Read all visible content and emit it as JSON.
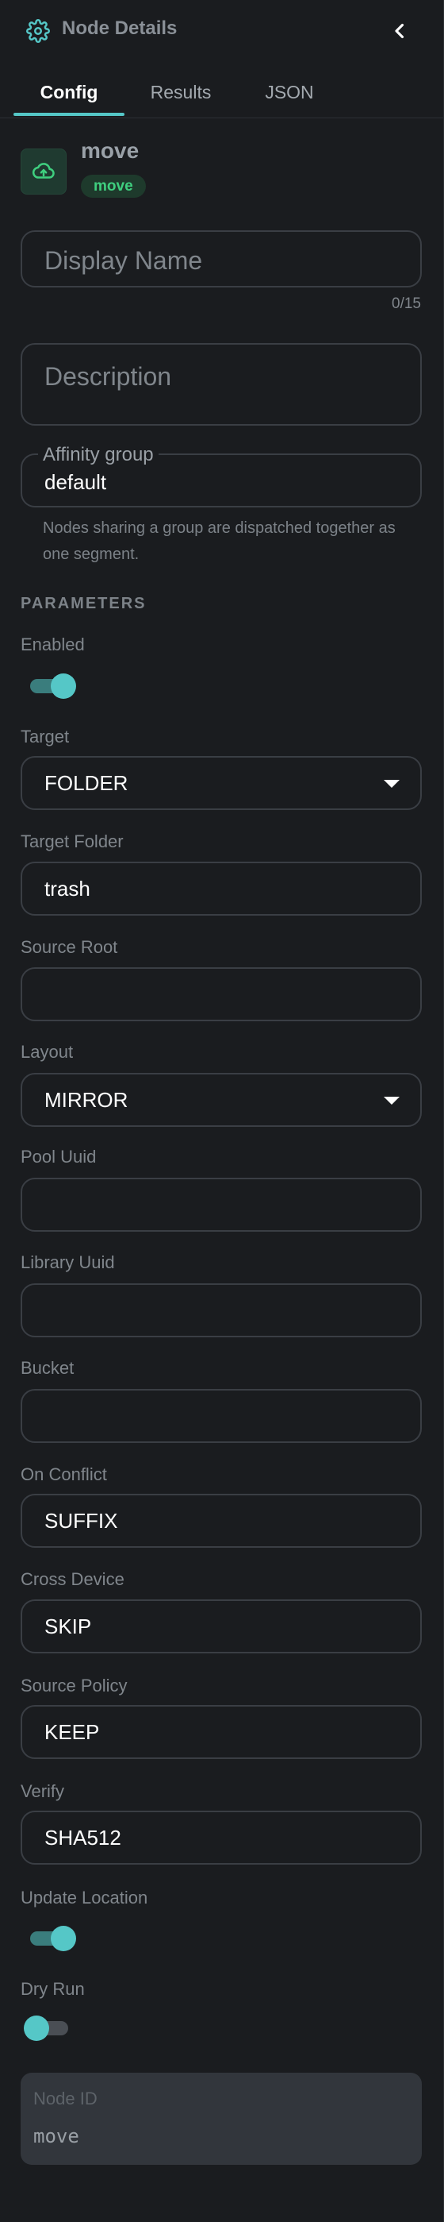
{
  "header": {
    "title": "Node Details",
    "icon": "gear-icon",
    "back_icon": "chevron-left-icon"
  },
  "tabs": [
    {
      "label": "Config",
      "active": true
    },
    {
      "label": "Results",
      "active": false
    },
    {
      "label": "JSON",
      "active": false
    }
  ],
  "node": {
    "name": "move",
    "badge": "move",
    "icon": "cloud-upload-icon",
    "badge_color": "#3fcf7f"
  },
  "display_name": {
    "placeholder": "Display Name",
    "value": "",
    "counter": "0/15"
  },
  "description": {
    "placeholder": "Description",
    "value": ""
  },
  "affinity": {
    "label": "Affinity group",
    "value": "default",
    "helper": "Nodes sharing a group are dispatched together as one segment."
  },
  "parameters": {
    "title": "PARAMETERS",
    "enabled": {
      "label": "Enabled",
      "on": true
    },
    "target": {
      "label": "Target",
      "value": "FOLDER"
    },
    "target_folder": {
      "label": "Target Folder",
      "value": "trash"
    },
    "source_root": {
      "label": "Source Root",
      "value": ""
    },
    "layout": {
      "label": "Layout",
      "value": "MIRROR"
    },
    "pool_uuid": {
      "label": "Pool Uuid",
      "value": ""
    },
    "library_uuid": {
      "label": "Library Uuid",
      "value": ""
    },
    "bucket": {
      "label": "Bucket",
      "value": ""
    },
    "on_conflict": {
      "label": "On Conflict",
      "value": "SUFFIX"
    },
    "cross_device": {
      "label": "Cross Device",
      "value": "SKIP"
    },
    "source_policy": {
      "label": "Source Policy",
      "value": "KEEP"
    },
    "verify": {
      "label": "Verify",
      "value": "SHA512"
    },
    "update_location": {
      "label": "Update Location",
      "on": true
    },
    "dry_run": {
      "label": "Dry Run",
      "on": false
    }
  },
  "node_id": {
    "label": "Node ID",
    "value": "move"
  },
  "colors": {
    "accent": "#55c7c7",
    "background": "#1a1c1f",
    "badge_bg": "#1e3a2c"
  }
}
